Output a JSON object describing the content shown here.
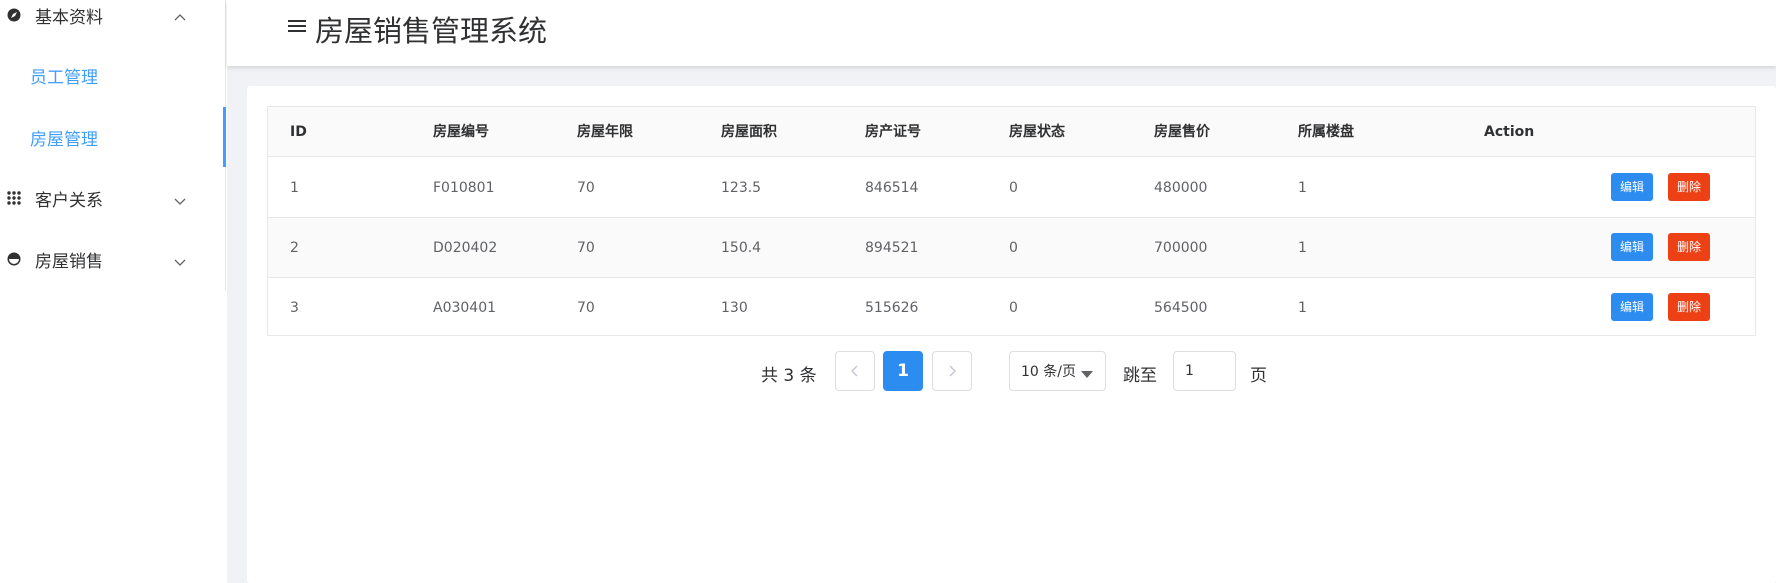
{
  "app": {
    "title": "房屋销售管理系统"
  },
  "sidebar": {
    "menus": [
      {
        "label": "基本资料",
        "icon": "compass-icon",
        "expanded": true
      },
      {
        "label": "客户关系",
        "icon": "grid-dots-icon",
        "expanded": false
      },
      {
        "label": "房屋销售",
        "icon": "pie-chart-icon",
        "expanded": false
      }
    ],
    "sub_items": [
      {
        "label": "员工管理",
        "active": false
      },
      {
        "label": "房屋管理",
        "active": true
      }
    ]
  },
  "table": {
    "columns": [
      "ID",
      "房屋编号",
      "房屋年限",
      "房屋面积",
      "房产证号",
      "房屋状态",
      "房屋售价",
      "所属楼盘",
      "Action"
    ],
    "rows": [
      [
        "1",
        "F010801",
        "70",
        "123.5",
        "846514",
        "0",
        "480000",
        "1"
      ],
      [
        "2",
        "D020402",
        "70",
        "150.4",
        "894521",
        "0",
        "700000",
        "1"
      ],
      [
        "3",
        "A030401",
        "70",
        "130",
        "515626",
        "0",
        "564500",
        "1"
      ]
    ],
    "actions": {
      "edit": "编辑",
      "delete": "删除"
    }
  },
  "pagination": {
    "total_text": "共 3 条",
    "current_page": "1",
    "page_size": "10 条/页",
    "jump_label": "跳至",
    "jump_value": "1",
    "page_label": "页"
  },
  "colors": {
    "accent": "#409eff",
    "primary_button": "#2d8cf0",
    "danger_button": "#ed4014",
    "background": "#f0f2f5"
  }
}
